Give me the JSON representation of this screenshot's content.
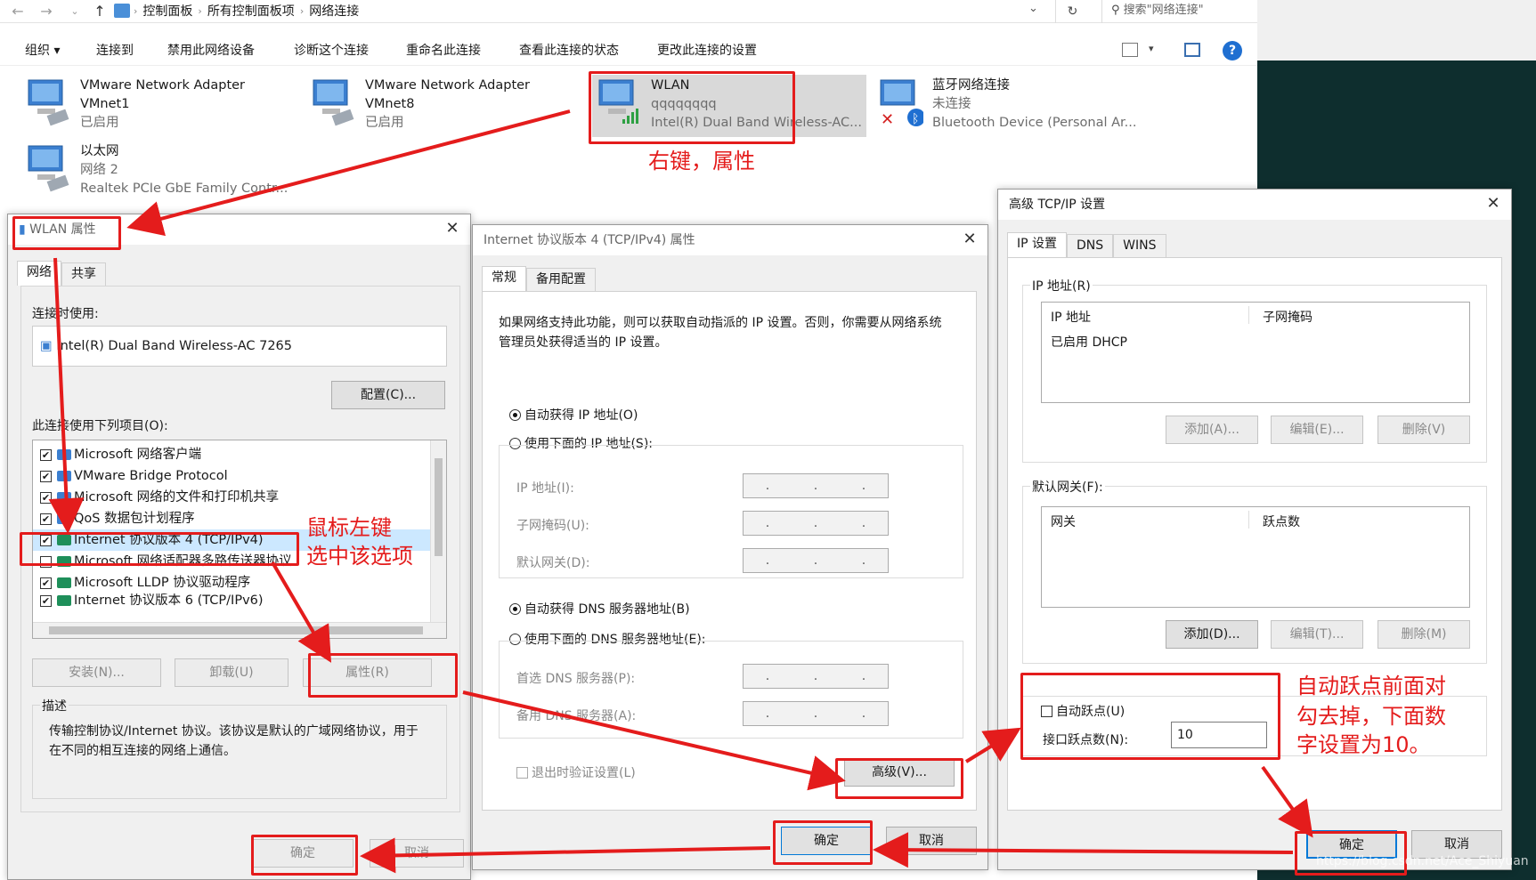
{
  "explorer": {
    "breadcrumb": [
      "控制面板",
      "所有控制面板项",
      "网络连接"
    ],
    "search_placeholder": "搜索\"网络连接\"",
    "commands": [
      "组织 ▾",
      "连接到",
      "禁用此网络设备",
      "诊断这个连接",
      "重命名此连接",
      "查看此连接的状态",
      "更改此连接的设置"
    ],
    "adapters": [
      {
        "name": "VMware Network Adapter",
        "line2": "VMnet1",
        "line3": "已启用"
      },
      {
        "name": "VMware Network Adapter",
        "line2": "VMnet8",
        "line3": "已启用"
      },
      {
        "name": "WLAN",
        "line2": "qqqqqqqq",
        "line3": "Intel(R) Dual Band Wireless-AC..."
      },
      {
        "name": "蓝牙网络连接",
        "line2": "未连接",
        "line3": "Bluetooth Device (Personal Ar..."
      },
      {
        "name": "以太网",
        "line2": "网络 2",
        "line3": "Realtek PCIe GbE Family Contr..."
      }
    ]
  },
  "wlan_props": {
    "title": "WLAN 属性",
    "tabs": [
      "网络",
      "共享"
    ],
    "connect_using_label": "连接时使用:",
    "adapter": "Intel(R) Dual Band Wireless-AC 7265",
    "configure_btn": "配置(C)...",
    "items_label": "此连接使用下列项目(O):",
    "items": [
      {
        "checked": "✔",
        "label": "Microsoft 网络客户端"
      },
      {
        "checked": "✔",
        "label": "VMware Bridge Protocol"
      },
      {
        "checked": "✔",
        "label": "Microsoft 网络的文件和打印机共享"
      },
      {
        "checked": "✔",
        "label": "QoS 数据包计划程序"
      },
      {
        "checked": "✔",
        "label": "Internet 协议版本 4 (TCP/IPv4)"
      },
      {
        "checked": "",
        "label": "Microsoft 网络适配器多路传送器协议"
      },
      {
        "checked": "✔",
        "label": "Microsoft LLDP 协议驱动程序"
      },
      {
        "checked": "✔",
        "label": "Internet 协议版本 6 (TCP/IPv6)"
      }
    ],
    "install_btn": "安装(N)...",
    "uninstall_btn": "卸载(U)",
    "properties_btn": "属性(R)",
    "desc_label": "描述",
    "description": "传输控制协议/Internet 协议。该协议是默认的广域网络协议，用于在不同的相互连接的网络上通信。",
    "ok_btn": "确定",
    "cancel_btn": "取消"
  },
  "ipv4_props": {
    "title": "Internet 协议版本 4 (TCP/IPv4) 属性",
    "tabs": [
      "常规",
      "备用配置"
    ],
    "intro": "如果网络支持此功能，则可以获取自动指派的 IP 设置。否则，你需要从网络系统管理员处获得适当的 IP 设置。",
    "auto_ip": "自动获得 IP 地址(O)",
    "manual_ip": "使用下面的 IP 地址(S):",
    "ip_label": "IP 地址(I):",
    "mask_label": "子网掩码(U):",
    "gateway_label": "默认网关(D):",
    "auto_dns": "自动获得 DNS 服务器地址(B)",
    "manual_dns": "使用下面的 DNS 服务器地址(E):",
    "pref_dns": "首选 DNS 服务器(P):",
    "alt_dns": "备用 DNS 服务器(A):",
    "validate": "退出时验证设置(L)",
    "advanced_btn": "高级(V)...",
    "ok_btn": "确定",
    "cancel_btn": "取消"
  },
  "adv_tcpip": {
    "title": "高级 TCP/IP 设置",
    "tabs": [
      "IP 设置",
      "DNS",
      "WINS"
    ],
    "ip_group": "IP 地址(R)",
    "col_ip": "IP 地址",
    "col_mask": "子网掩码",
    "dhcp_row": "已启用 DHCP",
    "add_btn": "添加(A)...",
    "edit_btn": "编辑(E)...",
    "delete_btn": "删除(V)",
    "gw_group": "默认网关(F):",
    "col_gw": "网关",
    "col_metric": "跃点数",
    "add_gw_btn": "添加(D)...",
    "edit_gw_btn": "编辑(T)...",
    "delete_gw_btn": "删除(M)",
    "auto_metric": "自动跃点(U)",
    "metric_label": "接口跃点数(N):",
    "metric_value": "10",
    "ok_btn": "确定",
    "cancel_btn": "取消"
  },
  "annotations": {
    "right_click": "右键，属性",
    "left_click_1": "鼠标左键",
    "left_click_2": "选中该选项",
    "metric_note_1": "自动跃点前面对",
    "metric_note_2": "勾去掉，下面数",
    "metric_note_3": "字设置为10。"
  },
  "watermark": "https://blog.csdn.net/Ace_Shiyuan",
  "colors": {
    "annotation_red": "#e41c1c",
    "dialog_bg": "#f0f0f0",
    "selection": "#cce8ff"
  }
}
